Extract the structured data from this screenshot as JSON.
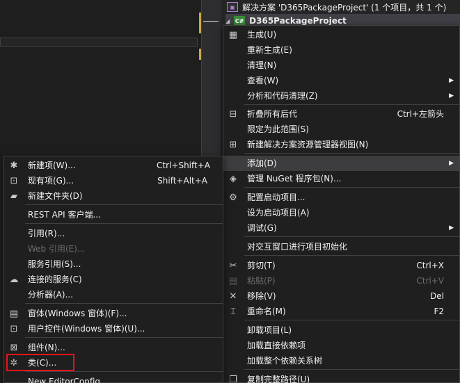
{
  "solution_explorer": {
    "solution_label": "解决方案 'D365PackageProject' (1 个项目，共 1 个)",
    "project_label": "D365PackageProject",
    "project_icon_text": "C#"
  },
  "main_menu": {
    "items": [
      {
        "label": "生成(U)",
        "shortcut": "",
        "icon": "build-icon"
      },
      {
        "label": "重新生成(E)",
        "shortcut": "",
        "icon": ""
      },
      {
        "label": "清理(N)",
        "shortcut": "",
        "icon": ""
      },
      {
        "label": "查看(W)",
        "shortcut": "",
        "icon": ""
      },
      {
        "label": "分析和代码清理(Z)",
        "shortcut": "",
        "icon": ""
      },
      {
        "label": "折叠所有后代",
        "shortcut": "Ctrl+左箭头",
        "icon": "collapse-icon"
      },
      {
        "label": "限定为此范围(S)",
        "shortcut": "",
        "icon": ""
      },
      {
        "label": "新建解决方案资源管理器视图(N)",
        "shortcut": "",
        "icon": "new-view-icon"
      },
      {
        "label": "添加(D)",
        "shortcut": "",
        "icon": ""
      },
      {
        "label": "管理 NuGet 程序包(N)...",
        "shortcut": "",
        "icon": "nuget-icon"
      },
      {
        "label": "配置启动项目...",
        "shortcut": "",
        "icon": "gear-icon"
      },
      {
        "label": "设为启动项目(A)",
        "shortcut": "",
        "icon": ""
      },
      {
        "label": "调试(G)",
        "shortcut": "",
        "icon": ""
      },
      {
        "label": "对交互窗口进行项目初始化",
        "shortcut": "",
        "icon": ""
      },
      {
        "label": "剪切(T)",
        "shortcut": "Ctrl+X",
        "icon": "cut-icon"
      },
      {
        "label": "粘贴(P)",
        "shortcut": "Ctrl+V",
        "icon": "paste-icon"
      },
      {
        "label": "移除(V)",
        "shortcut": "Del",
        "icon": "remove-icon"
      },
      {
        "label": "重命名(M)",
        "shortcut": "F2",
        "icon": "rename-icon"
      },
      {
        "label": "卸载项目(L)",
        "shortcut": "",
        "icon": ""
      },
      {
        "label": "加载直接依赖项",
        "shortcut": "",
        "icon": ""
      },
      {
        "label": "加载整个依赖关系树",
        "shortcut": "",
        "icon": ""
      },
      {
        "label": "复制完整路径(U)",
        "shortcut": "",
        "icon": "copy-path-icon"
      }
    ]
  },
  "add_submenu": {
    "items": [
      {
        "label": "新建项(W)...",
        "shortcut": "Ctrl+Shift+A",
        "icon": "new-item-icon"
      },
      {
        "label": "现有项(G)...",
        "shortcut": "Shift+Alt+A",
        "icon": "existing-item-icon"
      },
      {
        "label": "新建文件夹(D)",
        "shortcut": "",
        "icon": "new-folder-icon"
      },
      {
        "label": "REST API 客户端...",
        "shortcut": "",
        "icon": ""
      },
      {
        "label": "引用(R)...",
        "shortcut": "",
        "icon": ""
      },
      {
        "label": "Web 引用(E)...",
        "shortcut": "",
        "icon": ""
      },
      {
        "label": "服务引用(S)...",
        "shortcut": "",
        "icon": ""
      },
      {
        "label": "连接的服务(C)",
        "shortcut": "",
        "icon": "connected-service-icon"
      },
      {
        "label": "分析器(A)...",
        "shortcut": "",
        "icon": ""
      },
      {
        "label": "窗体(Windows 窗体)(F)...",
        "shortcut": "",
        "icon": "form-icon"
      },
      {
        "label": "用户控件(Windows 窗体)(U)...",
        "shortcut": "",
        "icon": "user-control-icon"
      },
      {
        "label": "组件(N)...",
        "shortcut": "",
        "icon": "component-icon"
      },
      {
        "label": "类(C)...",
        "shortcut": "",
        "icon": "class-icon"
      },
      {
        "label": "New EditorConfig",
        "shortcut": "",
        "icon": ""
      }
    ]
  },
  "colors": {
    "highlight_box": "#e8141a",
    "menu_background": "#1f1f1f",
    "hover_background": "#3d3d40"
  }
}
